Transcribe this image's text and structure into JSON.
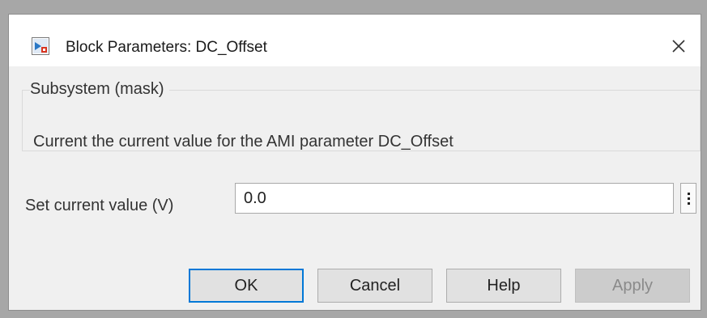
{
  "window": {
    "title": "Block Parameters: DC_Offset",
    "icon": "simulink-block-icon",
    "close_icon": "close-icon"
  },
  "group": {
    "title": "Subsystem (mask)",
    "description": "Current the current value for the AMI parameter DC_Offset"
  },
  "parameter": {
    "label": "Set current value (V)",
    "value": "0.0",
    "more_icon": "vertical-ellipsis-icon"
  },
  "buttons": {
    "ok": "OK",
    "cancel": "Cancel",
    "help": "Help",
    "apply": "Apply"
  },
  "colors": {
    "accent": "#0078d7",
    "dialog_bg": "#f0f0f0",
    "backdrop": "#a7a7a7"
  }
}
